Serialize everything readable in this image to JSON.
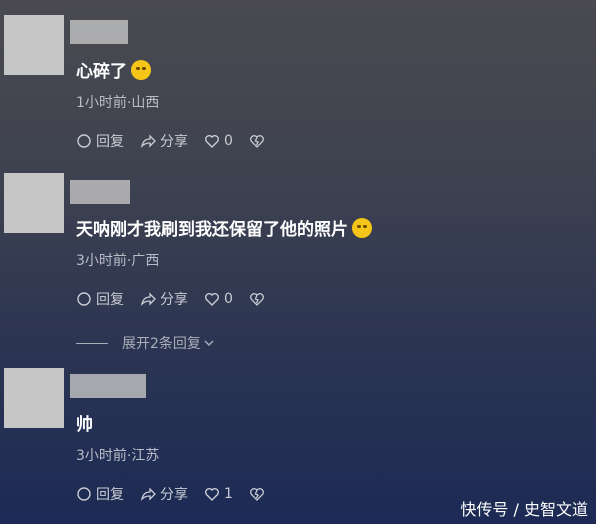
{
  "comments": [
    {
      "text": "心碎了",
      "emoji": "loudly-crying-face",
      "meta": "1小时前·山西",
      "reply_label": "回复",
      "share_label": "分享",
      "like_count": "0"
    },
    {
      "text": "天呐刚才我刷到我还保留了他的照片",
      "emoji": "rolling-laughing-face",
      "meta": "3小时前·广西",
      "reply_label": "回复",
      "share_label": "分享",
      "like_count": "0"
    },
    {
      "text": "帅",
      "meta": "3小时前·江苏",
      "reply_label": "回复",
      "share_label": "分享",
      "like_count": "1"
    }
  ],
  "expand_replies": "展开2条回复",
  "watermark": "快传号 / 史智文道",
  "colors": {
    "avatar": "#c6c6c6",
    "emoji": "#f5c518",
    "text": "#ffffff",
    "meta": "#b8bcc6"
  }
}
